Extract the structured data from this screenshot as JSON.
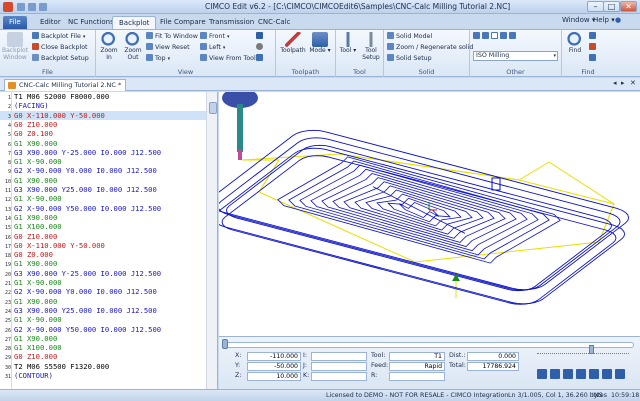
{
  "window": {
    "title": "CIMCO Edit v6.2 - [C:\\CIMCO\\CIMCOEdit6\\Samples\\CNC-Calc Milling Tutorial 2.NC]",
    "menu_right": [
      "Window",
      "Help"
    ]
  },
  "tabs": [
    {
      "label": "File"
    },
    {
      "label": "Editor"
    },
    {
      "label": "NC Functions"
    },
    {
      "label": "Backplot"
    },
    {
      "label": "File Compare"
    },
    {
      "label": "Transmission"
    },
    {
      "label": "CNC-Calc"
    }
  ],
  "ribbon": {
    "file_group": {
      "label": "File",
      "backplot_window": "Backplot Window",
      "backplot_file": "Backplot File",
      "close_backplot": "Close Backplot",
      "backplot_setup": "Backplot Setup"
    },
    "view_group": {
      "label": "View",
      "zoom_in": "Zoom In",
      "zoom_out": "Zoom Out",
      "fit_to_window": "Fit To Window",
      "view_reset": "View Reset",
      "top": "Top",
      "front": "Front",
      "left": "Left",
      "view_from_tool": "View From Tool"
    },
    "toolpath_group": {
      "label": "Toolpath",
      "toolpath": "Toolpath",
      "mode": "Mode"
    },
    "tool_group": {
      "label": "Tool",
      "tool": "Tool",
      "tool_setup": "Tool Setup"
    },
    "solid_group": {
      "label": "Solid",
      "solid_model": "Solid Model",
      "zoom_regenerate": "Zoom / Regenerate solid",
      "solid_setup": "Solid Setup"
    },
    "other_group": {
      "label": "Other",
      "combo_value": "ISO Milling"
    },
    "find_group": {
      "label": "Find",
      "find": "Find"
    }
  },
  "document_tab": {
    "label": "CNC-Calc Milling Tutorial 2.NC *"
  },
  "editor": {
    "lines": [
      {
        "n": "1",
        "text": "T1 M06 S2000 F8000.000",
        "color": "black"
      },
      {
        "n": "2",
        "text": "(FACING)",
        "color": "blue"
      },
      {
        "n": "3",
        "text": "G0 X-110.000 Y-50.000",
        "color": "red"
      },
      {
        "n": "4",
        "text": "G0 Z10.000",
        "color": "red"
      },
      {
        "n": "5",
        "text": "G0 Z0.100",
        "color": "red"
      },
      {
        "n": "6",
        "text": "G1 X90.000",
        "color": "green"
      },
      {
        "n": "7",
        "text": "G3 X90.000 Y-25.000 I0.000 J12.500",
        "color": "blue"
      },
      {
        "n": "8",
        "text": "G1 X-90.000",
        "color": "green"
      },
      {
        "n": "9",
        "text": "G2 X-90.000 Y0.000 I0.000 J12.500",
        "color": "blue"
      },
      {
        "n": "10",
        "text": "G1 X90.000",
        "color": "green"
      },
      {
        "n": "11",
        "text": "G3 X90.000 Y25.000 I0.000 J12.500",
        "color": "blue"
      },
      {
        "n": "12",
        "text": "G1 X-90.000",
        "color": "green"
      },
      {
        "n": "13",
        "text": "G2 X-90.000 Y50.000 I0.000 J12.500",
        "color": "blue"
      },
      {
        "n": "14",
        "text": "G1 X90.000",
        "color": "green"
      },
      {
        "n": "15",
        "text": "G1 X100.000",
        "color": "green"
      },
      {
        "n": "16",
        "text": "G0 Z10.000",
        "color": "red"
      },
      {
        "n": "17",
        "text": "G0 X-110.000 Y-50.000",
        "color": "red"
      },
      {
        "n": "18",
        "text": "G0 Z0.000",
        "color": "red"
      },
      {
        "n": "19",
        "text": "G1 X90.000",
        "color": "green"
      },
      {
        "n": "20",
        "text": "G3 X90.000 Y-25.000 I0.000 J12.500",
        "color": "blue"
      },
      {
        "n": "21",
        "text": "G1 X-90.000",
        "color": "green"
      },
      {
        "n": "22",
        "text": "G2 X-90.000 Y0.000 I0.000 J12.500",
        "color": "blue"
      },
      {
        "n": "23",
        "text": "G1 X90.000",
        "color": "green"
      },
      {
        "n": "24",
        "text": "G3 X90.000 Y25.000 I0.000 J12.500",
        "color": "blue"
      },
      {
        "n": "25",
        "text": "G1 X-90.000",
        "color": "green"
      },
      {
        "n": "26",
        "text": "G2 X-90.000 Y50.000 I0.000 J12.500",
        "color": "blue"
      },
      {
        "n": "27",
        "text": "G1 X90.000",
        "color": "green"
      },
      {
        "n": "28",
        "text": "G1 X100.000",
        "color": "green"
      },
      {
        "n": "29",
        "text": "G0 Z10.000",
        "color": "red"
      },
      {
        "n": "30",
        "text": "T2 M06 S5500 F1320.000",
        "color": "black"
      },
      {
        "n": "31",
        "text": "(CONTOUR)",
        "color": "blue"
      }
    ]
  },
  "readout": {
    "x_label": "X:",
    "x_value": "-110.000",
    "y_label": "Y:",
    "y_value": "-50.000",
    "z_label": "Z:",
    "z_value": "10.000",
    "i_label": "I:",
    "j_label": "J:",
    "k_label": "K:",
    "tool_label": "Tool:",
    "tool_value": "T1",
    "feed_label": "Feed:",
    "feed_value": "Rapid",
    "r_label": "R:",
    "dist_label": "Dist.:",
    "dist_value": "0.000",
    "total_label": "Total:",
    "total_value": "17786.924"
  },
  "status_bar": {
    "license": "Licensed to DEMO - NOT FOR RESALE - CIMCO Integration",
    "position": "Ln 3/1.005, Col 1, 36.260 bytes",
    "mode": "INS",
    "time": "10:59:18"
  },
  "colors": {
    "toolpath": "#0a10c8",
    "rapid": "#e8e000",
    "tool": "#2a8a8a"
  }
}
